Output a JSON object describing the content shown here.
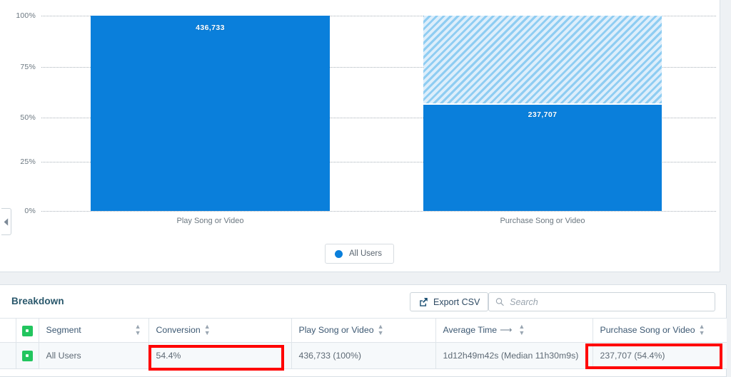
{
  "chart": {
    "y_axis": {
      "ticks": [
        "100%",
        "75%",
        "50%",
        "25%",
        "0%"
      ]
    },
    "legend": {
      "label": "All Users",
      "color": "#0a7fdb",
      "icon": "circle-icon"
    },
    "collapse_handle_icon": "chevron-left-icon"
  },
  "chart_data": {
    "type": "bar",
    "title": "",
    "xlabel": "",
    "ylabel": "",
    "ylim": [
      0,
      100
    ],
    "grid": true,
    "legend_position": "bottom-center",
    "categories": [
      "Play Song or Video",
      "Purchase Song or Video"
    ],
    "series": [
      {
        "name": "All Users",
        "values": [
          100,
          54.4
        ],
        "value_labels": [
          "436,733",
          "237,707"
        ],
        "color": "#0a7fdb"
      },
      {
        "name": "Drop-off",
        "values": [
          0,
          45.6
        ],
        "color": "#ddeefb",
        "pattern": "diagonal-hatch"
      }
    ]
  },
  "breakdown": {
    "title": "Breakdown",
    "export_button": {
      "label": "Export CSV",
      "icon": "external-link-icon"
    },
    "search": {
      "placeholder": "Search",
      "value": "",
      "icon": "search-icon"
    },
    "table": {
      "columns": [
        {
          "label": "",
          "sortable": false
        },
        {
          "label": "Segment",
          "sortable": true
        },
        {
          "label": "Conversion",
          "sortable": true
        },
        {
          "label": "Play Song or Video",
          "sortable": true
        },
        {
          "label": "Average Time",
          "sortable": true,
          "suffix_icon": "arrow-right-icon"
        },
        {
          "label": "Purchase Song or Video",
          "sortable": true
        }
      ],
      "rows": [
        {
          "marker_icon": "green-square-icon",
          "segment": "All Users",
          "conversion": "54.4%",
          "play_song_or_video": "436,733 (100%)",
          "average_time": "1d12h49m42s (Median 11h30m9s)",
          "purchase_song_or_video": "237,707 (54.4%)"
        }
      ]
    }
  },
  "annotations": {
    "highlight_color": "#ff0000",
    "boxes": [
      "conversion-cell",
      "purchase-cell"
    ]
  }
}
